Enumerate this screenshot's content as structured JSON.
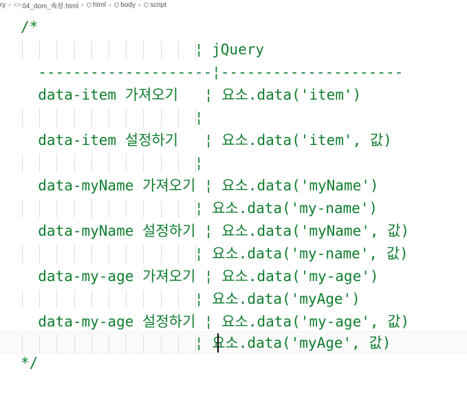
{
  "breadcrumb": {
    "items": [
      {
        "icon": "",
        "label": "ry"
      },
      {
        "icon": "<>",
        "label": "04_dom_속성.html"
      },
      {
        "icon": "⌬",
        "label": "html"
      },
      {
        "icon": "⌬",
        "label": "body"
      },
      {
        "icon": "⌬",
        "label": "script"
      }
    ]
  },
  "code_lines": [
    "/*",
    "                    ¦ jQuery",
    "  --------------------¦---------------------",
    "  data-item 가져오기   ¦ 요소.data('item')",
    "                    ¦",
    "  data-item 설정하기   ¦ 요소.data('item', 값)",
    "                    ¦",
    "  data-myName 가져오기 ¦ 요소.data('myName')",
    "                    ¦ 요소.data('my-name')",
    "  data-myName 설정하기 ¦ 요소.data('myName', 값)",
    "                    ¦ 요소.data('my-name', 값)",
    "  data-my-age 가져오기 ¦ 요소.data('my-age')",
    "                    ¦ 요소.data('myAge')",
    "  data-my-age 설정하기 ¦ 요소.data('my-age', 값)",
    "                    ¦ 요소.data('myAge', 값)",
    "*/"
  ],
  "colors": {
    "comment": "#0f7d2d",
    "guide": "#dcdcdc",
    "background": "#ffffff"
  }
}
